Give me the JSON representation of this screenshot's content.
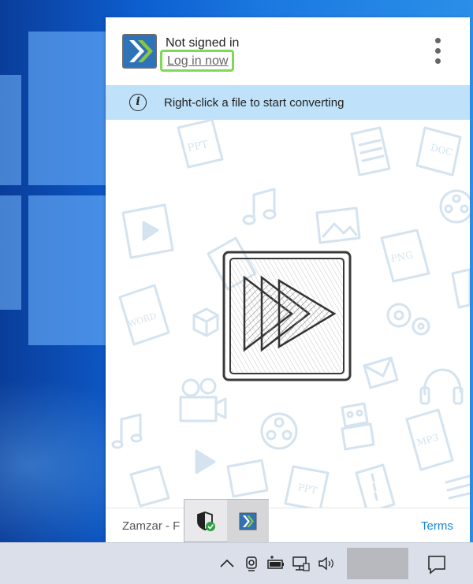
{
  "app": {
    "status": "Not signed in",
    "login_link": "Log in now",
    "banner_text": "Right-click a file to start converting",
    "footer_left": "Zamzar - F",
    "footer_terms": "Terms"
  },
  "doodles": {
    "ppt": "PPT",
    "doc": "DOC",
    "png": "PNG",
    "word": "WORD",
    "mp3": "MP3",
    "ppt2": "PPT"
  },
  "colors": {
    "accent_green": "#7ed957",
    "banner_bg": "#bfe2fa",
    "link_blue": "#1a86d4",
    "doodle": "#d4e3ef"
  },
  "tray_popup": {
    "items": [
      {
        "icon": "windows-security-shield-icon"
      },
      {
        "icon": "zamzar-app-icon"
      }
    ]
  },
  "taskbar": {
    "icons": [
      "chevron-up-icon",
      "webcam-icon",
      "battery-icon",
      "network-icon",
      "volume-icon",
      "notification-icon"
    ]
  }
}
